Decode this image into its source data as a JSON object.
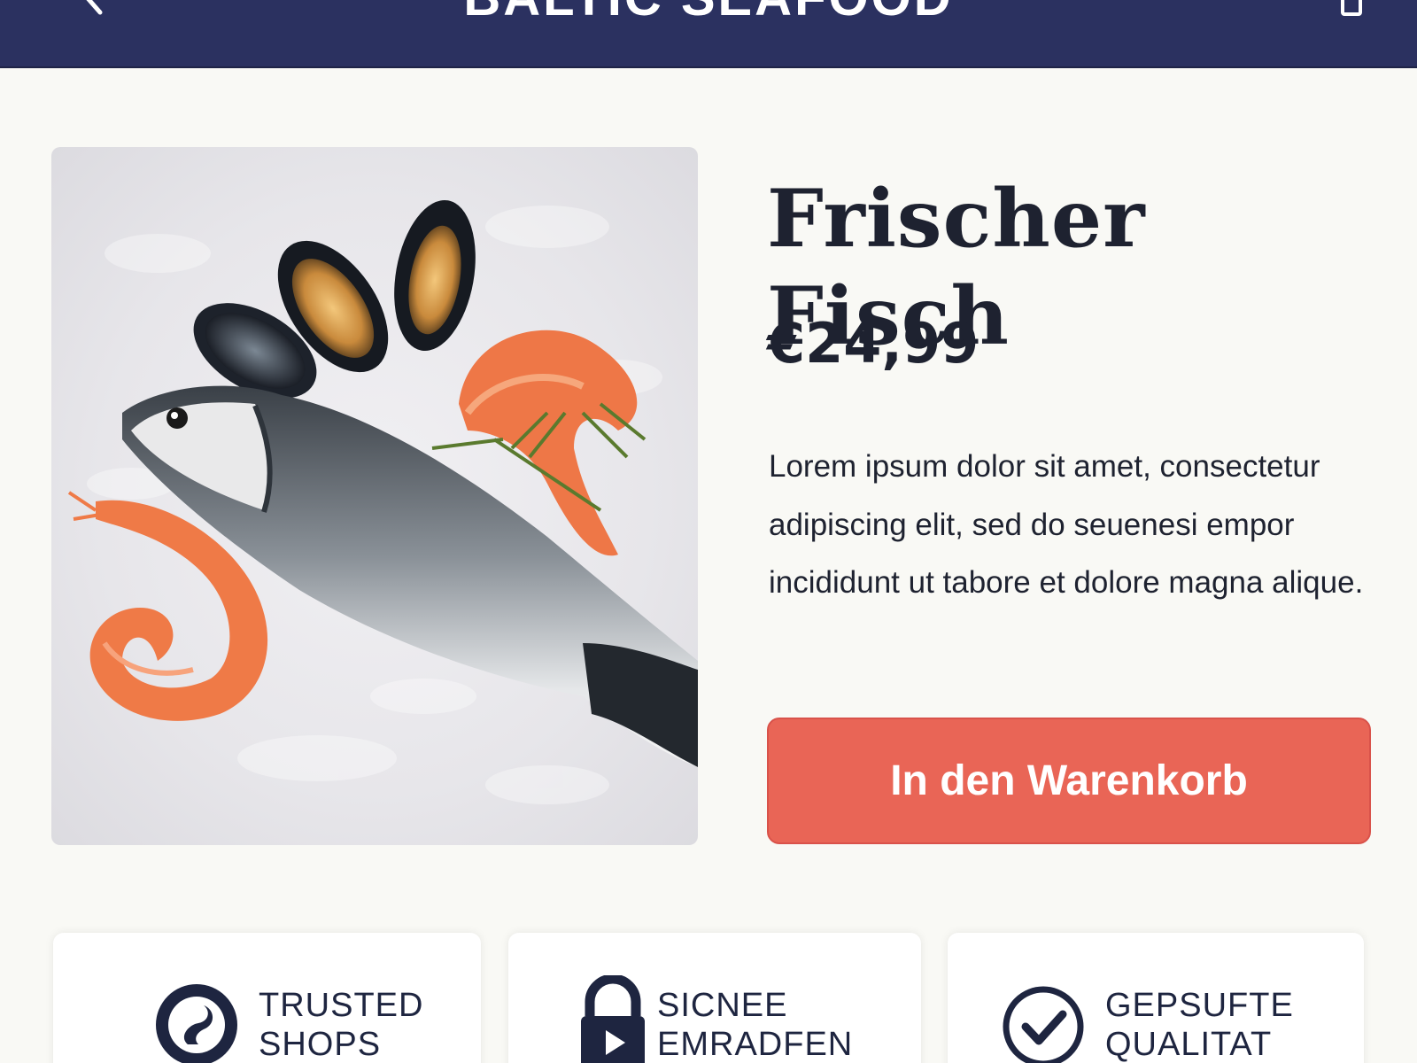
{
  "header": {
    "brand": "BALTIC SEAFOOD",
    "back_icon": "chevron-left-icon",
    "cart_icon": "bag-icon",
    "background": "#2b3160"
  },
  "product": {
    "image_alt": "fish-with-mussels-and-shrimp",
    "title": "Frischer Fisch",
    "price": "€24,99",
    "description": "Lorem ipsum dolor sit amet, consectetur adipiscing elit, sed do seuenesi empor incididunt ut tabore et dolore magna alique.",
    "cta_label": "In den Warenkorb",
    "cta_color": "#e96556"
  },
  "trust_badges": [
    {
      "icon": "trusted-shops-icon",
      "line1": "TRUSTED",
      "line2": "SHOPS"
    },
    {
      "icon": "lock-icon",
      "line1": "SICNEE",
      "line2": "EMRADFEN"
    },
    {
      "icon": "checkmark-circle-icon",
      "line1": "GEPSUFTE",
      "line2": "QUALITAT"
    }
  ]
}
